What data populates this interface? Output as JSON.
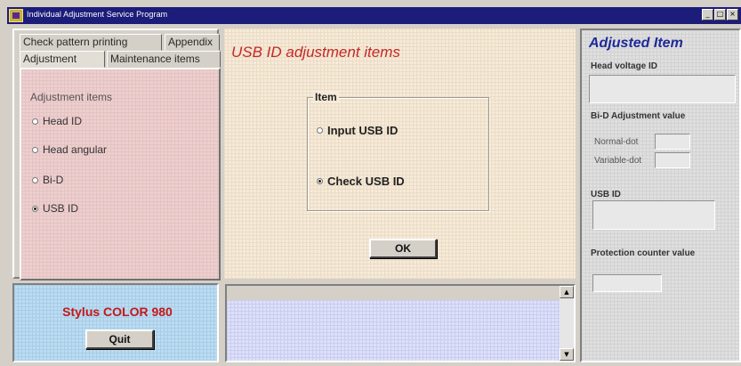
{
  "window": {
    "title": "Individual Adjustment Service Program",
    "controls": [
      "minimize",
      "maximize",
      "close"
    ]
  },
  "left_panel": {
    "tabs": [
      {
        "label": "Check pattern printing",
        "active": false
      },
      {
        "label": "Appendix",
        "active": false
      },
      {
        "label": "Adjustment",
        "active": true
      },
      {
        "label": "Maintenance items",
        "active": false
      }
    ],
    "group_label": "Adjustment items",
    "options": [
      {
        "label": "Head ID",
        "selected": false
      },
      {
        "label": "Head angular",
        "selected": false
      },
      {
        "label": "Bi-D",
        "selected": false
      },
      {
        "label": "USB ID",
        "selected": true
      }
    ]
  },
  "center_panel": {
    "title": "USB ID adjustment items",
    "group_label": "Item",
    "options": [
      {
        "label": "Input USB ID",
        "selected": false
      },
      {
        "label": "Check USB ID",
        "selected": true
      }
    ],
    "ok_label": "OK"
  },
  "right_panel": {
    "title": "Adjusted Item",
    "head_voltage_label": "Head voltage ID",
    "head_voltage_value": "",
    "bid_label": "Bi-D Adjustment value",
    "bid_normal_label": "Normal-dot",
    "bid_normal_value": "",
    "bid_variable_label": "Variable-dot",
    "bid_variable_value": "",
    "usb_id_label": "USB ID",
    "usb_id_value": "",
    "protection_label": "Protection counter value",
    "protection_value": ""
  },
  "bottom_left": {
    "model_name": "Stylus COLOR 980",
    "quit_label": "Quit"
  },
  "log": {
    "text": ""
  },
  "colors": {
    "title_bar": "#1c1c7a",
    "center_title": "#c42828",
    "right_title": "#1f2a9a",
    "model_name": "#c41818"
  }
}
